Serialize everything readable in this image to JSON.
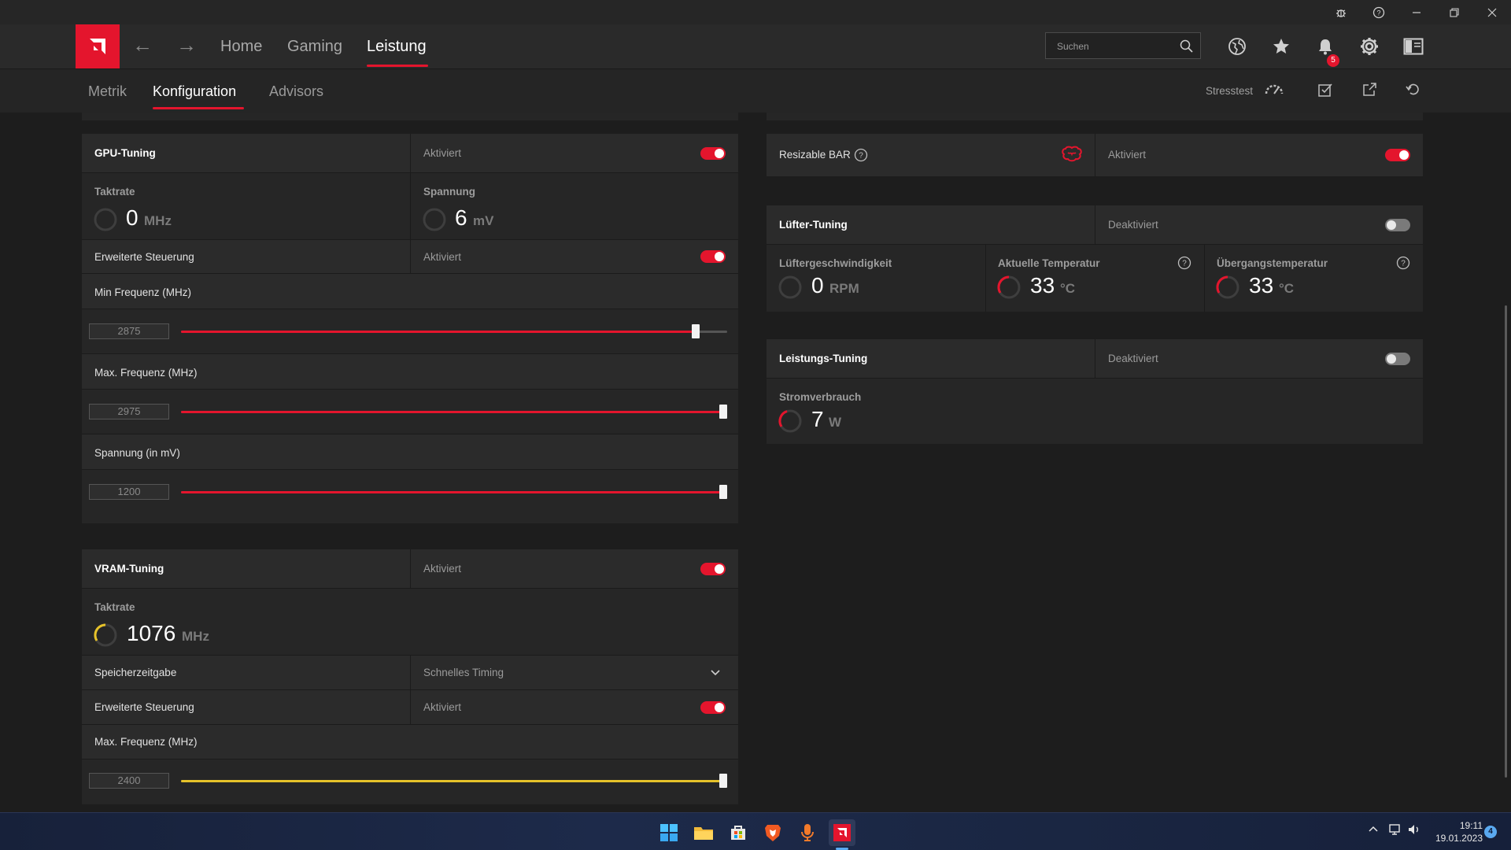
{
  "app": {
    "nav": {
      "home": "Home",
      "gaming": "Gaming",
      "leistung": "Leistung"
    },
    "search_placeholder": "Suchen",
    "notification_count": "5",
    "accent_color": "#e4152d",
    "vram_accent_color": "#e6c22a"
  },
  "subnav": {
    "tabs": [
      "Metrik",
      "Konfiguration",
      "Advisors"
    ],
    "stresstest_label": "Stresstest"
  },
  "gpu_tuning": {
    "title": "GPU-Tuning",
    "status": "Aktiviert",
    "taktrate_label": "Taktrate",
    "taktrate_value": "0",
    "taktrate_unit": "MHz",
    "spannung_label": "Spannung",
    "spannung_value": "6",
    "spannung_unit": "mV",
    "erweitert_label": "Erweiterte Steuerung",
    "erweitert_status": "Aktiviert",
    "min_freq_label": "Min Frequenz (MHz)",
    "min_freq_value": "2875",
    "min_freq_fraction": 0.95,
    "max_freq_label": "Max. Frequenz (MHz)",
    "max_freq_value": "2975",
    "max_freq_fraction": 1.0,
    "spannung_mv_label": "Spannung (in mV)",
    "spannung_mv_value": "1200",
    "spannung_mv_fraction": 1.0
  },
  "vram_tuning": {
    "title": "VRAM-Tuning",
    "status": "Aktiviert",
    "taktrate_label": "Taktrate",
    "taktrate_value": "1076",
    "taktrate_unit": "MHz",
    "speicher_label": "Speicherzeitgabe",
    "speicher_value": "Schnelles Timing",
    "erweitert_label": "Erweiterte Steuerung",
    "erweitert_status": "Aktiviert",
    "max_freq_label": "Max. Frequenz (MHz)",
    "max_freq_value": "2400",
    "max_freq_fraction": 1.0
  },
  "resizable_bar": {
    "title": "Resizable BAR",
    "status": "Aktiviert"
  },
  "fan_tuning": {
    "title": "Lüfter-Tuning",
    "status": "Deaktiviert",
    "speed_label": "Lüftergeschwindigkeit",
    "speed_value": "0",
    "speed_unit": "RPM",
    "temp_label": "Aktuelle Temperatur",
    "temp_value": "33",
    "temp_unit": "°C",
    "junction_label": "Übergangstemperatur",
    "junction_value": "33",
    "junction_unit": "°C"
  },
  "power_tuning": {
    "title": "Leistungs-Tuning",
    "status": "Deaktiviert",
    "power_label": "Stromverbrauch",
    "power_value": "7",
    "power_unit": "W"
  },
  "taskbar": {
    "time": "19:11",
    "date": "19.01.2023",
    "notification_count": "4"
  }
}
